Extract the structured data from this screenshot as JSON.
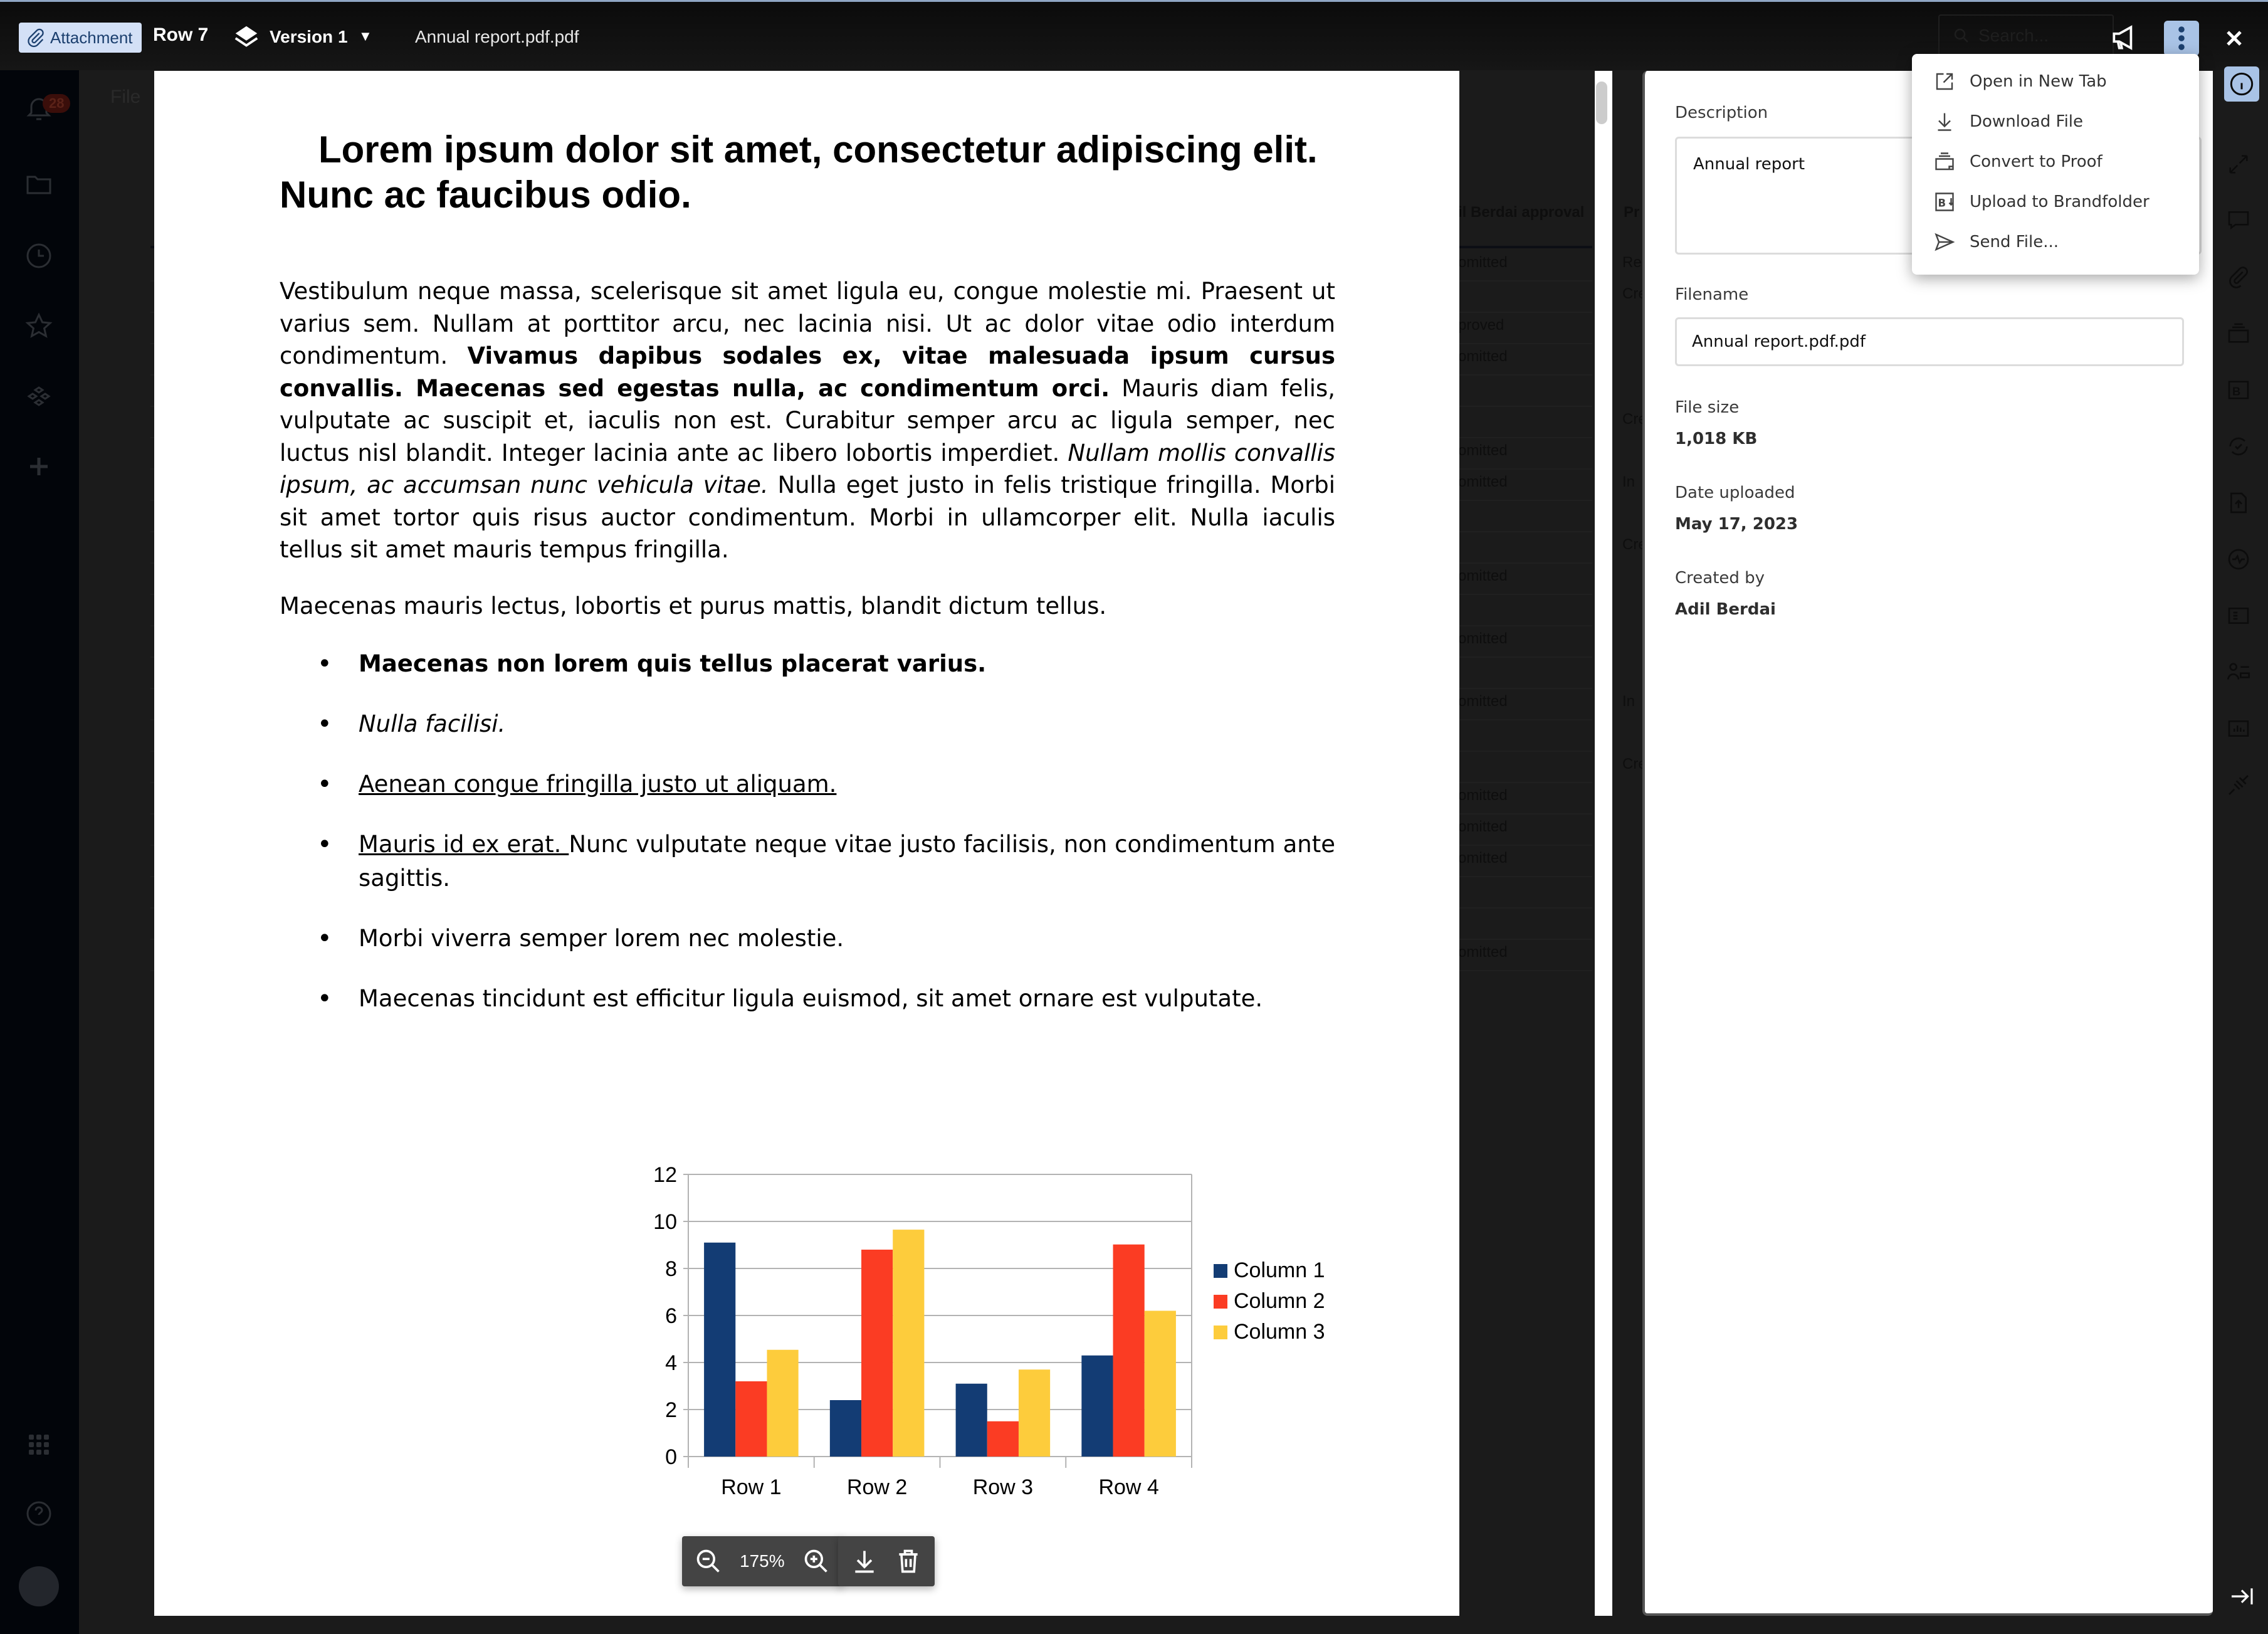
{
  "topbar": {
    "attachment_chip": "Attachment",
    "row_label": "Row 7",
    "version_label": "Version 1",
    "filename": "Annual report.pdf.pdf",
    "search_placeholder": "Search...",
    "icons": [
      "paperclip-icon",
      "layers-icon",
      "caret-down-icon",
      "megaphone-icon",
      "more-vertical-icon",
      "close-icon"
    ],
    "accent_color": "#a9c3e6",
    "chip_color": "#d3e0f6"
  },
  "background_app": {
    "menu_file": "File",
    "notification_count": "28",
    "column_headers": [
      "il Berdai approval",
      "Pr"
    ],
    "column_cells": [
      {
        "a": "omitted",
        "b": "Re"
      },
      {
        "a": "",
        "b": "Cre"
      },
      {
        "a": "proved",
        "b": ""
      },
      {
        "a": "omitted",
        "b": ""
      },
      {
        "a": "",
        "b": ""
      },
      {
        "a": "",
        "b": "Cre"
      },
      {
        "a": "omitted",
        "b": ""
      },
      {
        "a": "omitted",
        "b": "In"
      },
      {
        "a": "",
        "b": ""
      },
      {
        "a": "",
        "b": "Cre"
      },
      {
        "a": "omitted",
        "b": ""
      },
      {
        "a": "",
        "b": ""
      },
      {
        "a": "omitted",
        "b": ""
      },
      {
        "a": "",
        "b": ""
      },
      {
        "a": "omitted",
        "b": "In"
      },
      {
        "a": "",
        "b": ""
      },
      {
        "a": "",
        "b": "Cre"
      },
      {
        "a": "omitted",
        "b": ""
      },
      {
        "a": "omitted",
        "b": ""
      },
      {
        "a": "omitted",
        "b": ""
      },
      {
        "a": "",
        "b": ""
      },
      {
        "a": "",
        "b": ""
      },
      {
        "a": "omitted",
        "b": ""
      }
    ]
  },
  "document": {
    "title": "Lorem ipsum dolor sit amet, consectetur adipiscing elit. Nunc ac faucibus odio.",
    "para1": {
      "normal_1": "Vestibulum neque massa, scelerisque sit amet ligula eu, congue molestie mi. Praesent ut varius sem. Nullam at porttitor arcu, nec lacinia nisi. Ut ac dolor vitae odio interdum condimentum. ",
      "bold": "Vivamus dapibus sodales ex, vitae malesuada ipsum cursus convallis. Maecenas sed egestas nulla, ac condimentum orci.",
      "normal_2": " Mauris diam felis, vulputate ac suscipit et, iaculis non est. Curabitur semper arcu ac ligula semper, nec luctus nisl blandit. Integer lacinia ante ac libero lobortis imperdiet. ",
      "italic": "Nullam mollis convallis ipsum, ac accumsan nunc vehicula vitae.",
      "normal_3": " Nulla eget justo in felis tristique fringilla. Morbi sit amet tortor quis risus auctor condimentum. Morbi in ullamcorper elit. Nulla iaculis tellus sit amet mauris tempus fringilla."
    },
    "para2": "Maecenas mauris lectus, lobortis et purus mattis, blandit dictum tellus.",
    "bullets": {
      "b1": "Maecenas non lorem quis tellus placerat varius.",
      "b2": "Nulla facilisi.",
      "b3": "Aenean congue fringilla justo ut aliquam. ",
      "b4_underline": "Mauris id ex erat. ",
      "b4_rest": "Nunc vulputate neque vitae justo facilisis, non condimentum ante sagittis.",
      "b5": "Morbi viverra semper lorem nec molestie.",
      "b6": "Maecenas tincidunt est efficitur ligula euismod, sit amet ornare est vulputate."
    }
  },
  "chart_data": {
    "type": "bar",
    "title": "",
    "xlabel": "",
    "ylabel": "",
    "categories": [
      "Row 1",
      "Row 2",
      "Row 3",
      "Row 4"
    ],
    "series": [
      {
        "name": "Column 1",
        "color": "#133c74",
        "values": [
          9.1,
          2.4,
          3.1,
          4.3
        ]
      },
      {
        "name": "Column 2",
        "color": "#fb3c23",
        "values": [
          3.2,
          8.8,
          1.5,
          9.02
        ]
      },
      {
        "name": "Column 3",
        "color": "#fdcc3c",
        "values": [
          4.54,
          9.65,
          3.7,
          6.2
        ]
      }
    ],
    "ylim": [
      0,
      12
    ],
    "yticks": [
      "0",
      "2",
      "4",
      "6",
      "8",
      "10",
      "12"
    ],
    "grid": true,
    "legend": "right"
  },
  "viewer_controls": {
    "zoom_level": "175%",
    "icons": [
      "zoom-out-icon",
      "zoom-in-icon",
      "download-icon",
      "trash-icon"
    ]
  },
  "details": {
    "description_label": "Description",
    "description_value": "Annual report",
    "filename_label": "Filename",
    "filename_value": "Annual report.pdf.pdf",
    "filesize_label": "File size",
    "filesize_value": "1,018 KB",
    "date_label": "Date uploaded",
    "date_value": "May 17, 2023",
    "creator_label": "Created by",
    "creator_value": "Adil Berdai"
  },
  "dropdown_menu": {
    "items": [
      {
        "label": "Open in New Tab",
        "icon": "external-link-icon"
      },
      {
        "label": "Download File",
        "icon": "download-icon"
      },
      {
        "label": "Convert to Proof",
        "icon": "proof-icon"
      },
      {
        "label": "Upload to Brandfolder",
        "icon": "brandfolder-icon"
      },
      {
        "label": "Send File...",
        "icon": "send-icon"
      }
    ]
  },
  "right_rail": {
    "icons": [
      "info-icon",
      "expand-icon",
      "comment-icon",
      "paperclip-icon",
      "proof-icon",
      "brandfolder-icon",
      "sync-icon",
      "file-upload-icon",
      "activity-icon",
      "summary-icon",
      "people-icon",
      "report-icon",
      "connector-icon",
      "collapse-panel-icon"
    ]
  }
}
